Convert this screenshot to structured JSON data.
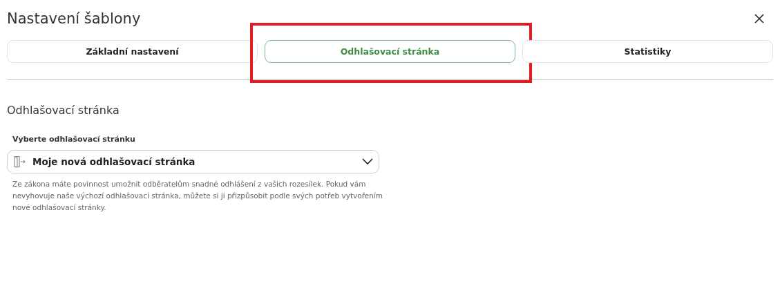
{
  "window": {
    "title": "Nastavení šablony"
  },
  "tabs": [
    {
      "label": "Základní nastavení",
      "selected": false,
      "highlighted": false
    },
    {
      "label": "Odhlašovací stránka",
      "selected": true,
      "highlighted": true
    },
    {
      "label": "Statistiky",
      "selected": false,
      "highlighted": false
    }
  ],
  "section": {
    "title": "Odhlašovací stránka",
    "field_label": "Vyberte odhlašovací stránku",
    "select_value": "Moje nová odhlašovací stránka",
    "help": "Ze zákona máte povinnost umožnit odběratelům snadné odhlášení z vašich rozesílek. Pokud vám nevyhovuje naše výchozí odhlašovací stránka, můžete si ji přizpůsobit podle svých potřeb vytvořením nové odhlašovací stránky."
  }
}
